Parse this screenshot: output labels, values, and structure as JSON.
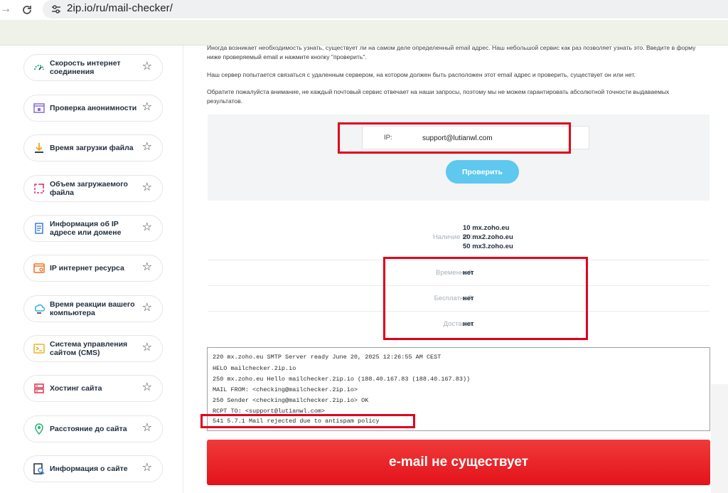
{
  "browser": {
    "url": "2ip.io/ru/mail-checker/",
    "icons": [
      "forward-arrow-icon",
      "reload-icon",
      "site-settings-icon"
    ]
  },
  "sidebar": {
    "items": [
      {
        "label": "Скорость интернет соединения",
        "icon": "speedometer-icon"
      },
      {
        "label": "Проверка анонимности",
        "icon": "lock-window-icon"
      },
      {
        "label": "Время загрузки файла",
        "icon": "download-icon"
      },
      {
        "label": "Объем загружаемого файла",
        "icon": "resize-icon"
      },
      {
        "label": "Информация об IP адресе или домене",
        "icon": "document-icon"
      },
      {
        "label": "IP интернет ресурса",
        "icon": "browser-window-icon"
      },
      {
        "label": "Время реакции вашего компьютера",
        "icon": "cloud-computer-icon"
      },
      {
        "label": "Система управления сайтом (CMS)",
        "icon": "terminal-icon"
      },
      {
        "label": "Хостинг сайта",
        "icon": "server-icon"
      },
      {
        "label": "Расстояние до сайта",
        "icon": "location-pin-icon"
      },
      {
        "label": "Информация о сайте",
        "icon": "search-document-icon"
      }
    ]
  },
  "main": {
    "intro": [
      "Иногда возникает необходимость узнать, существует ли на самом деле определенный email адрес. Наш небольшой сервис как раз позволяет узнать это. Введите в форму ниже проверяемый email и нажмите кнопку \"проверить\".",
      "Наш сервер попытается связаться с удаленным сервером, на котором должен быть расположен этот email адрес и проверить, существует он или нет.",
      "Обратите пожалуйста внимание, не каждый почтовый сервис отвечает на наши запросы, поэтому мы не можем гарантировать абсолютной точности выдаваемых результатов."
    ],
    "form": {
      "ip_label": "IP:",
      "email_value": "support@lutianwl.com",
      "check_button": "Проверить"
    },
    "mx": {
      "label": "Наличие MX:",
      "records": [
        "10 mx.zoho.eu",
        "20 mx2.zoho.eu",
        "50 mx3.zoho.eu"
      ]
    },
    "results": [
      {
        "label": "Временный:",
        "value": "нет"
      },
      {
        "label": "Бесплатный:",
        "value": "нет"
      },
      {
        "label": "Доставка:",
        "value": "нет"
      }
    ],
    "log": [
      "220 mx.zoho.eu SMTP Server ready June 20, 2025 12:26:55 AM CEST",
      "HELO mailchecker.2ip.io",
      "250 mx.zoho.eu Hello mailchecker.2ip.io (188.40.167.83 (188.40.167.83))",
      "MAIL FROM: <checking@mailchecker.2ip.io>",
      "250 Sender <checking@mailchecker.2ip.io> OK",
      "RCPT TO: <support@lutianwl.com>",
      "541 5.7.1 Mail rejected due to antispam policy"
    ],
    "result_text": "e-mail не существует"
  },
  "colors": {
    "highlight": "#e0001b",
    "button": "#5ec8ee",
    "banner": "#e3131a",
    "sidebar_accent": "#22b573"
  }
}
